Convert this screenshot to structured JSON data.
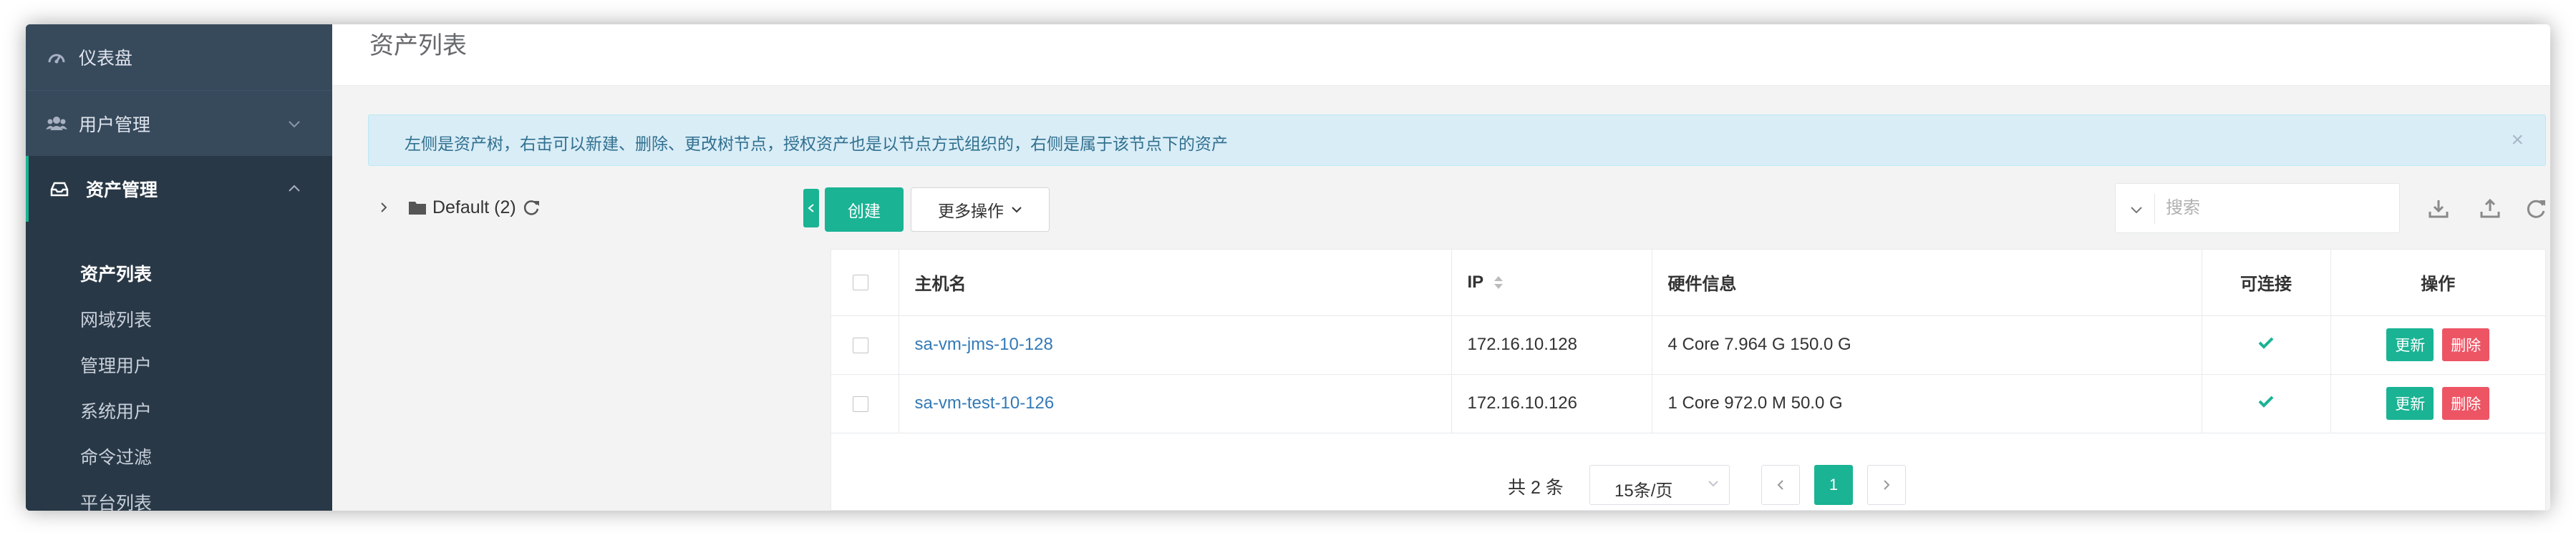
{
  "sidebar": {
    "dashboard": {
      "label": "仪表盘",
      "icon": "dashboard-icon"
    },
    "users": {
      "label": "用户管理",
      "icon": "users-icon"
    },
    "assets": {
      "label": "资产管理",
      "icon": "inbox-icon"
    },
    "sub_items": [
      "资产列表",
      "网域列表",
      "管理用户",
      "系统用户",
      "命令过滤",
      "平台列表"
    ],
    "active_sub": "资产列表"
  },
  "header": {
    "title": "资产列表"
  },
  "alert": {
    "text": "左侧是资产树，右击可以新建、删除、更改树节点，授权资产也是以节点方式组织的，右侧是属于该节点下的资产",
    "close": "×"
  },
  "tree": {
    "root_label": "Default (2)"
  },
  "toolbar": {
    "create_label": "创建",
    "more_label": "更多操作",
    "search_placeholder": "搜索"
  },
  "table": {
    "columns": [
      "主机名",
      "IP",
      "硬件信息",
      "可连接",
      "操作"
    ],
    "rows": [
      {
        "hostname": "sa-vm-jms-10-128",
        "ip": "172.16.10.128",
        "hardware": "4 Core 7.964 G 150.0 G",
        "update": "更新",
        "delete": "删除"
      },
      {
        "hostname": "sa-vm-test-10-126",
        "ip": "172.16.10.126",
        "hardware": "1 Core 972.0 M 50.0 G",
        "update": "更新",
        "delete": "删除"
      }
    ]
  },
  "pagination": {
    "total": "共 2 条",
    "page_size": "15条/页",
    "current_page": "1"
  },
  "colors": {
    "sidebar": "#2f4050",
    "accent": "#1ab394",
    "danger": "#ed5565",
    "link": "#337ab7",
    "alert_bg": "#d9edf7"
  }
}
